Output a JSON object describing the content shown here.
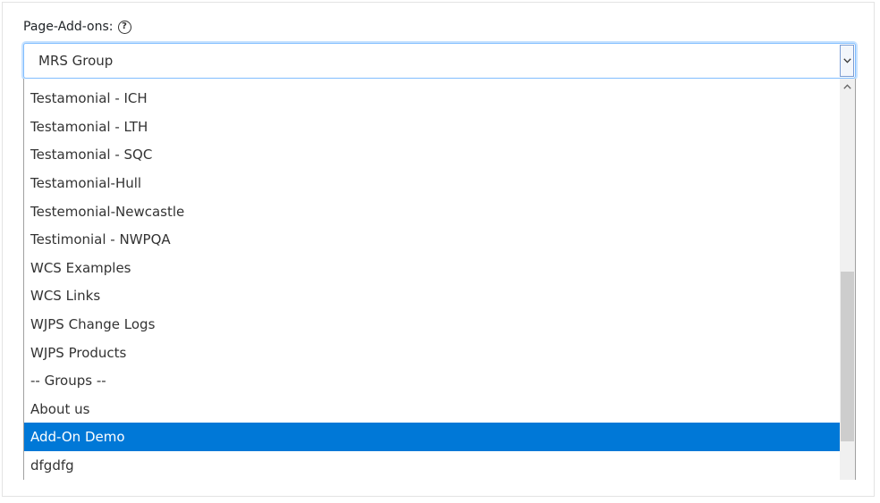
{
  "field": {
    "label": "Page-Add-ons:",
    "help_icon": "question-circle-icon"
  },
  "select": {
    "value": "MRS Group",
    "arrow_icon": "chevron-down-icon"
  },
  "dropdown": {
    "options": [
      {
        "label": "Testamonial - ICH",
        "selected": false
      },
      {
        "label": "Testamonial - LTH",
        "selected": false
      },
      {
        "label": "Testamonial - SQC",
        "selected": false
      },
      {
        "label": "Testamonial-Hull",
        "selected": false
      },
      {
        "label": "Testemonial-Newcastle",
        "selected": false
      },
      {
        "label": "Testimonial - NWPQA",
        "selected": false
      },
      {
        "label": "WCS Examples",
        "selected": false
      },
      {
        "label": "WCS Links",
        "selected": false
      },
      {
        "label": "WJPS Change Logs",
        "selected": false
      },
      {
        "label": "WJPS Products",
        "selected": false
      },
      {
        "label": "-- Groups --",
        "selected": false
      },
      {
        "label": "About us",
        "selected": false
      },
      {
        "label": "Add-On Demo",
        "selected": true
      },
      {
        "label": "dfgdfg",
        "selected": false
      }
    ],
    "selected_bg": "#0078d7",
    "scroll_up_icon": "chevron-up-icon"
  }
}
